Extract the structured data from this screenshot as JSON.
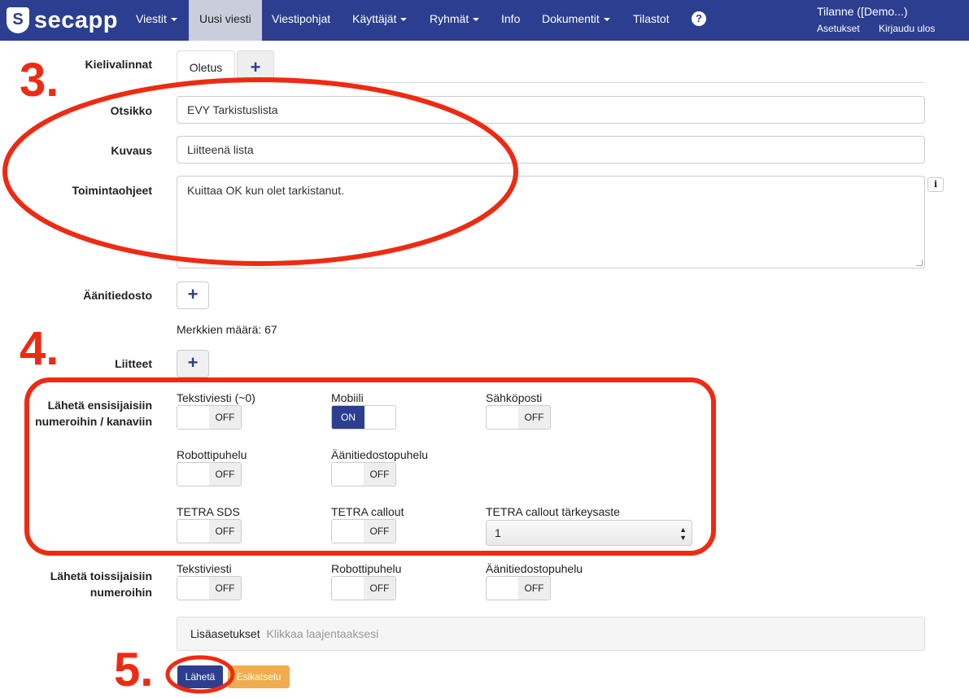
{
  "nav": {
    "brand": "secapp",
    "items": [
      {
        "label": "Viestit",
        "dropdown": true
      },
      {
        "label": "Uusi viesti",
        "active": true
      },
      {
        "label": "Viestipohjat"
      },
      {
        "label": "Käyttäjät",
        "dropdown": true
      },
      {
        "label": "Ryhmät",
        "dropdown": true
      },
      {
        "label": "Info"
      },
      {
        "label": "Dokumentit",
        "dropdown": true
      },
      {
        "label": "Tilastot"
      }
    ],
    "help_icon": "question-circle-icon",
    "user": "Tilanne  ([Demo...)",
    "settings": "Asetukset",
    "logout": "Kirjaudu ulos"
  },
  "form": {
    "lang_label": "Kielivalinnat",
    "lang_tab": "Oletus",
    "title_label": "Otsikko",
    "title_value": "EVY Tarkistuslista",
    "desc_label": "Kuvaus",
    "desc_value": "Liitteenä lista",
    "instr_label": "Toimintaohjeet",
    "instr_value": "Kuittaa OK kun olet tarkistanut.",
    "audio_label": "Äänitiedosto",
    "char_count": "Merkkien määrä: 67",
    "attach_label": "Liitteet",
    "primary_label_1": "Lähetä ensisijaisiin",
    "primary_label_2": "numeroihin / kanaviin",
    "primary": [
      {
        "label": "Tekstiviesti (~0)",
        "state": "OFF"
      },
      {
        "label": "Mobiili",
        "state": "ON"
      },
      {
        "label": "Sähköposti",
        "state": "OFF"
      },
      {
        "label": "Robottipuhelu",
        "state": "OFF"
      },
      {
        "label": "Äänitiedostopuhelu",
        "state": "OFF"
      },
      {
        "label": "TETRA SDS",
        "state": "OFF"
      },
      {
        "label": "TETRA callout",
        "state": "OFF"
      }
    ],
    "priority_label": "TETRA callout tärkeysaste",
    "priority_value": "1",
    "secondary_label_1": "Lähetä toissijaisiin",
    "secondary_label_2": "numeroihin",
    "secondary": [
      {
        "label": "Tekstiviesti",
        "state": "OFF"
      },
      {
        "label": "Robottipuhelu",
        "state": "OFF"
      },
      {
        "label": "Äänitiedostopuhelu",
        "state": "OFF"
      }
    ],
    "advanced_title": "Lisäasetukset",
    "advanced_hint": "Klikkaa laajentaaksesi",
    "submit": "Lähetä",
    "preview": "Esikatselu"
  },
  "annotations": {
    "n3": "3.",
    "n4": "4.",
    "n5": "5.",
    "color": "#ef2a12"
  },
  "colors": {
    "navbar": "#2c3e8f",
    "active_tab": "#c9cedc",
    "toggle_on": "#2c3e8f",
    "preview_button": "#f0ad4e"
  }
}
